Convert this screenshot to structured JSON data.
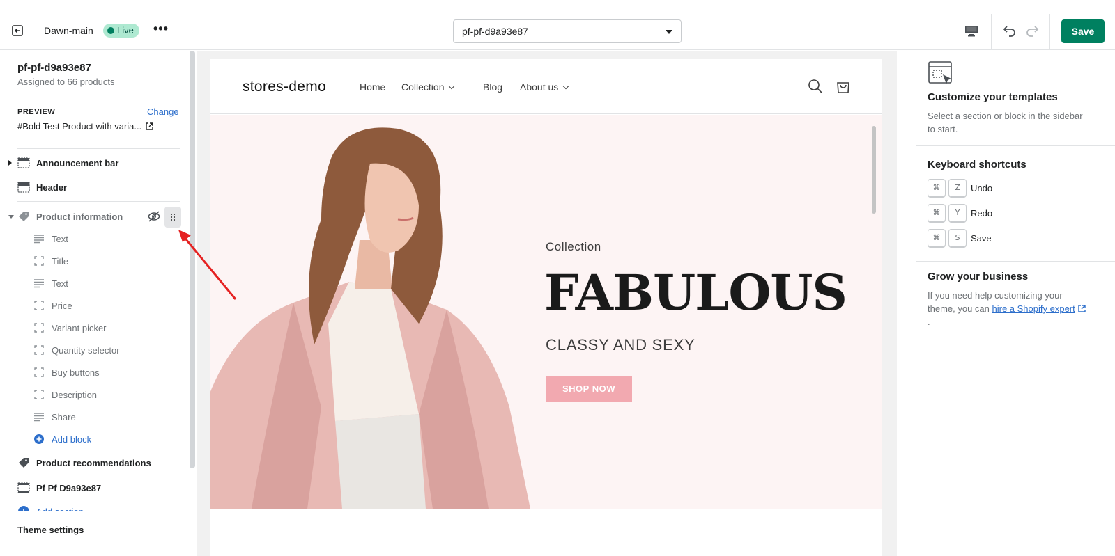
{
  "topbar": {
    "theme_name": "Dawn-main",
    "live_badge": "Live",
    "more": "•••",
    "template_select": "pf-pf-d9a93e87",
    "save_label": "Save"
  },
  "sidebar": {
    "template_name": "pf-pf-d9a93e87",
    "assigned": "Assigned to 66 products",
    "preview_label": "PREVIEW",
    "change_label": "Change",
    "preview_product": "#Bold Test Product with varia...",
    "sections": [
      {
        "label": "Announcement bar",
        "icon": "announcement-bar-icon"
      },
      {
        "label": "Header",
        "icon": "header-icon"
      },
      {
        "label": "Product information",
        "icon": "tag-icon"
      }
    ],
    "blocks": [
      {
        "label": "Text",
        "icon": "text-lines-icon"
      },
      {
        "label": "Title",
        "icon": "block-frame-icon"
      },
      {
        "label": "Text",
        "icon": "text-lines-icon"
      },
      {
        "label": "Price",
        "icon": "block-frame-icon"
      },
      {
        "label": "Variant picker",
        "icon": "block-frame-icon"
      },
      {
        "label": "Quantity selector",
        "icon": "block-frame-icon"
      },
      {
        "label": "Buy buttons",
        "icon": "block-frame-icon"
      },
      {
        "label": "Description",
        "icon": "block-frame-icon"
      },
      {
        "label": "Share",
        "icon": "text-lines-icon"
      }
    ],
    "add_block": "Add block",
    "more_sections": [
      {
        "label": "Product recommendations",
        "icon": "tag-icon"
      },
      {
        "label": "Pf Pf D9a93e87",
        "icon": "section-icon"
      }
    ],
    "add_section": "Add section",
    "theme_settings": "Theme settings"
  },
  "store": {
    "name": "stores-demo",
    "nav": [
      "Home",
      "Collection",
      "Blog",
      "About us"
    ],
    "hero": {
      "eyebrow": "Collection",
      "title": "FABULOUS",
      "subtitle": "CLASSY AND SEXY",
      "button": "SHOP NOW"
    }
  },
  "right_panel": {
    "customize_title": "Customize your templates",
    "customize_text": "Select a section or block in the sidebar to start.",
    "shortcuts_title": "Keyboard shortcuts",
    "shortcuts": [
      {
        "mod": "⌘",
        "key": "Z",
        "label": "Undo"
      },
      {
        "mod": "⌘",
        "key": "Y",
        "label": "Redo"
      },
      {
        "mod": "⌘",
        "key": "S",
        "label": "Save"
      }
    ],
    "grow_title": "Grow your business",
    "grow_text_1": "If you need help customizing your theme, you can ",
    "grow_link": "hire a Shopify expert",
    "grow_text_2": " ."
  },
  "colors": {
    "accent": "#008060",
    "link": "#2c6ecb",
    "hero_bg": "#fdf4f4",
    "hero_button": "#f2a9b0",
    "annotation": "#e52222"
  }
}
